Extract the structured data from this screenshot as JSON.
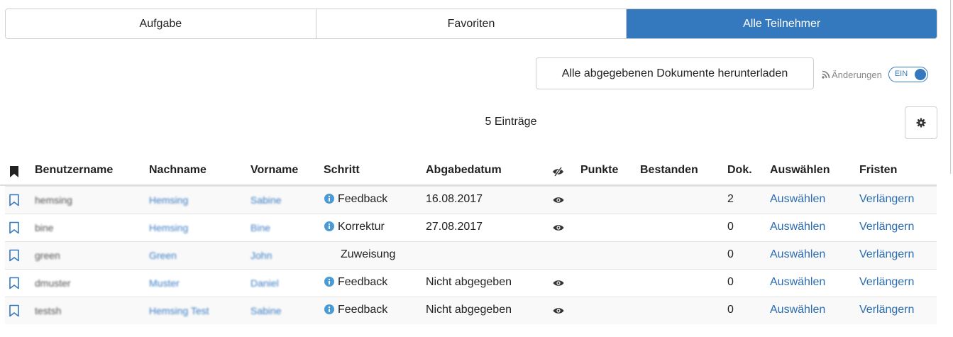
{
  "tabs": [
    {
      "label": "Aufgabe",
      "active": false
    },
    {
      "label": "Favoriten",
      "active": false
    },
    {
      "label": "Alle Teilnehmer",
      "active": true
    }
  ],
  "toolbar": {
    "download_label": "Alle abgegebenen Dokumente herunterladen",
    "changes_label": "Änderungen",
    "toggle_label": "EIN"
  },
  "entries_count": "5 Einträge",
  "table": {
    "headers": [
      "Benutzername",
      "Nachname",
      "Vorname",
      "Schritt",
      "Abgabedatum",
      "Punkte",
      "Bestanden",
      "Dok.",
      "Auswählen",
      "Fristen"
    ],
    "rows": [
      {
        "username": "hemsing",
        "lastname": "Hemsing",
        "firstname": "Sabine",
        "step": "Feedback",
        "step_info": true,
        "date": "16.08.2017",
        "eye": true,
        "points": "",
        "passed": "",
        "docs": "2",
        "select": "Auswählen",
        "deadline": "Verlängern"
      },
      {
        "username": "bine",
        "lastname": "Hemsing",
        "firstname": "Bine",
        "step": "Korrektur",
        "step_info": true,
        "date": "27.08.2017",
        "eye": true,
        "points": "",
        "passed": "",
        "docs": "0",
        "select": "Auswählen",
        "deadline": "Verlängern"
      },
      {
        "username": "green",
        "lastname": "Green",
        "firstname": "John",
        "step": "Zuweisung",
        "step_info": false,
        "date": "",
        "eye": false,
        "points": "",
        "passed": "",
        "docs": "0",
        "select": "Auswählen",
        "deadline": "Verlängern"
      },
      {
        "username": "dmuster",
        "lastname": "Muster",
        "firstname": "Daniel",
        "step": "Feedback",
        "step_info": true,
        "date": "Nicht abgegeben",
        "eye": true,
        "points": "",
        "passed": "",
        "docs": "0",
        "select": "Auswählen",
        "deadline": "Verlängern"
      },
      {
        "username": "testsh",
        "lastname": "Hemsing Test",
        "firstname": "Sabine",
        "step": "Feedback",
        "step_info": true,
        "date": "Nicht abgegeben",
        "eye": true,
        "points": "",
        "passed": "",
        "docs": "0",
        "select": "Auswählen",
        "deadline": "Verlängern"
      }
    ]
  },
  "colors": {
    "accent": "#3479bd",
    "link": "#2a6cb0",
    "info": "#4a9ad8"
  }
}
